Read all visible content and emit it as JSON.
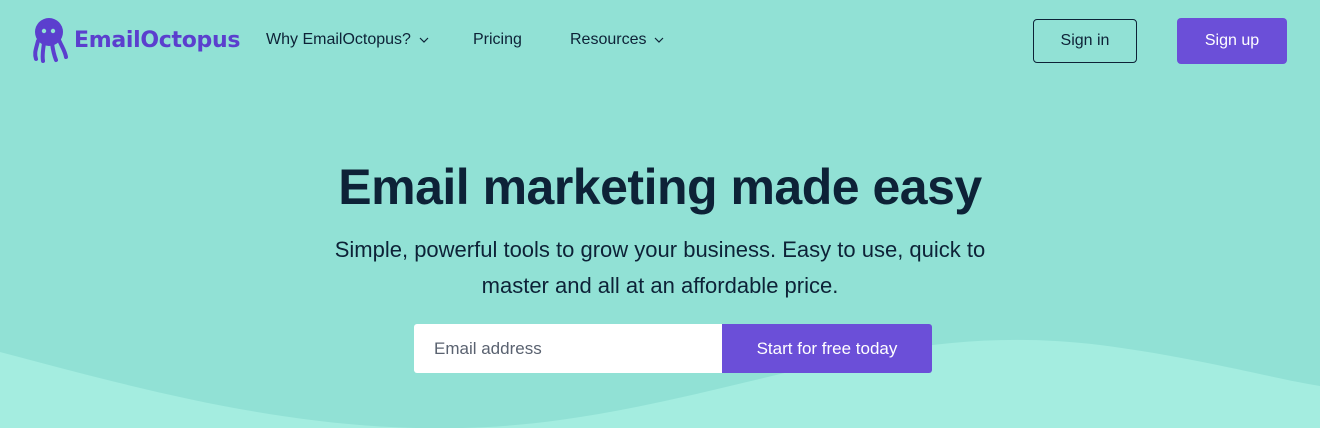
{
  "brand": {
    "name": "EmailOctopus",
    "logo_icon": "octopus-icon",
    "color": "#5b3fce"
  },
  "colors": {
    "background": "#91e1d5",
    "wave": "#a4ede0",
    "accent": "#6b4fd8",
    "text": "#0d2237"
  },
  "nav": {
    "items": [
      {
        "label": "Why EmailOctopus?",
        "has_dropdown": true
      },
      {
        "label": "Pricing",
        "has_dropdown": false
      },
      {
        "label": "Resources",
        "has_dropdown": true
      }
    ],
    "sign_in": "Sign in",
    "sign_up": "Sign up"
  },
  "hero": {
    "title": "Email marketing made easy",
    "subtitle": "Simple, powerful tools to grow your business. Easy to use, quick to master and all at an affordable price.",
    "email_placeholder": "Email address",
    "email_value": "",
    "cta": "Start for free today"
  }
}
